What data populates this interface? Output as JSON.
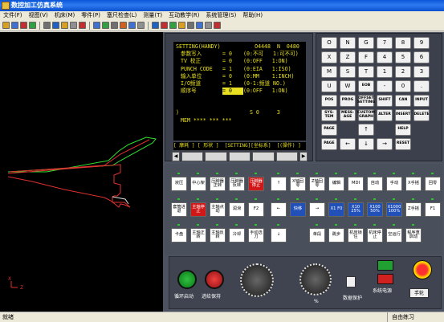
{
  "window": {
    "title": "数控加工仿真系统"
  },
  "menu": [
    "文件(F)",
    "视图(V)",
    "机床(M)",
    "零件(P)",
    "塞尺检查(L)",
    "测量(T)",
    "互动教学(R)",
    "系统管理(S)",
    "帮助(H)"
  ],
  "screen": {
    "header_left": "SETTING(HANDY)",
    "header_o": "O4448",
    "header_n": "N  0480",
    "rows": [
      {
        "label": "参数写入",
        "val": "= 0",
        "note": "(0:不可   1:可不可)"
      },
      {
        "label": "TV 校正",
        "val": "= 0",
        "note": "(0:OFF   1:ON)"
      },
      {
        "label": "PUNCH CODE",
        "val": "= 1",
        "note": "(0:EIA   1:ISO)"
      },
      {
        "label": "输入单位",
        "val": "= 0",
        "note": "(0:MM    1:INCH)"
      },
      {
        "label": "I/O频道",
        "val": "= 1",
        "note": "(0-1:频道 NO.)"
      },
      {
        "label": "顺序号",
        "val": "= 0",
        "note": "(0:OFF   1:ON)"
      }
    ],
    "prompt": ")",
    "s_label": "S 0",
    "t_label": "3",
    "mem_line": "MEM **** *** ***",
    "softkeys": "[ 摩耗 ] [ 形状 ]  [SETTING][坐标系]  [(操作) ]"
  },
  "keypad": [
    [
      "O",
      "N",
      "G",
      "7",
      "8",
      "9"
    ],
    [
      "X",
      "Z",
      "F",
      "4",
      "5",
      "6"
    ],
    [
      "M",
      "S",
      "T",
      "1",
      "2",
      "3"
    ],
    [
      "U",
      "W",
      "EOB",
      "-",
      "0",
      "."
    ],
    [
      "POS",
      "PROG",
      "OFFSET SETTING",
      "SHIFT",
      "CAN",
      "INPUT"
    ],
    [
      "SYS-TEM",
      "MESS-AGE",
      "CUSTOM GRAPH",
      "ALTER",
      "INSERT",
      "DELETE"
    ],
    [
      "PAGE",
      "",
      "↑",
      "",
      "HELP",
      ""
    ],
    [
      "PAGE",
      "←",
      "↓",
      "→",
      "RESET",
      ""
    ]
  ],
  "op_buttons": {
    "r1": [
      "液压",
      "中心架",
      "压脚器正转",
      "压脚器反转",
      "压脚器停止",
      "↑",
      "X轴回零",
      "Z轴回零",
      "编辑",
      "MDI",
      "自动",
      "手动",
      "X手摇",
      "回零"
    ],
    "r2": [
      "套筒进退",
      "主轴停止",
      "主轴点动",
      "润滑",
      "F2",
      "←",
      "快移",
      "→",
      "X1 F0",
      "X10 25%",
      "X100 50%",
      "X1000 100%",
      "Z手摇",
      "F1"
    ],
    "r3": [
      "卡盘",
      "主轴正转",
      "主轴反转",
      "冷却",
      "手动选刀",
      "↓",
      "单段",
      "跳步",
      "机床锁住",
      "机床停止",
      "空运行",
      "程序重启动"
    ]
  },
  "labels": {
    "cycle_start": "循环启动",
    "feed_hold": "进给保持",
    "data_protect": "数据保护",
    "power": "系统电源",
    "handwheel": "手轮",
    "spindle_pct": "%"
  },
  "status": {
    "left": "就绪",
    "right": "自由练习"
  },
  "colors": {
    "screen_fg": "#e8e020",
    "panel": "#4d5260",
    "title": "#0a56d8"
  }
}
